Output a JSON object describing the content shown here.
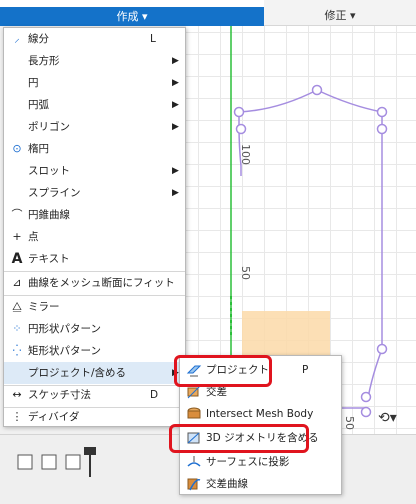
{
  "toolbar": {
    "create_label": "作成 ▾",
    "modify_label": "修正 ▾"
  },
  "create_menu": {
    "items": [
      {
        "label": "線分",
        "shortcut": "L",
        "icon": "line-icon"
      },
      {
        "label": "長方形",
        "submenu": true
      },
      {
        "label": "円",
        "submenu": true
      },
      {
        "label": "円弧",
        "submenu": true
      },
      {
        "label": "ポリゴン",
        "submenu": true
      },
      {
        "label": "楕円",
        "icon": "ellipse-icon"
      },
      {
        "label": "スロット",
        "submenu": true
      },
      {
        "label": "スプライン",
        "submenu": true
      },
      {
        "label": "円錐曲線",
        "icon": "conic-icon"
      },
      {
        "label": "点",
        "icon": "point-icon"
      },
      {
        "label": "テキスト",
        "icon": "text-icon"
      },
      {
        "label": "曲線をメッシュ断面にフィット",
        "icon": "fit-curve-icon"
      },
      {
        "label": "ミラー",
        "icon": "mirror-icon"
      },
      {
        "label": "円形状パターン",
        "icon": "circular-pattern-icon"
      },
      {
        "label": "矩形状パターン",
        "icon": "rectangular-pattern-icon"
      },
      {
        "label": "プロジェクト/含める",
        "submenu": true
      },
      {
        "label": "スケッチ寸法",
        "shortcut": "D",
        "icon": "dimension-icon"
      },
      {
        "label": "ディバイダ",
        "icon": "divider-icon"
      }
    ]
  },
  "submenu": {
    "items": [
      {
        "label": "プロジェクト",
        "shortcut": "P",
        "icon": "project-icon"
      },
      {
        "label": "交差",
        "icon": "intersect-icon"
      },
      {
        "label": "Intersect Mesh Body",
        "icon": "intersect-mesh-icon"
      },
      {
        "label": "3D ジオメトリを含める",
        "icon": "include-3d-icon"
      },
      {
        "label": "サーフェスに投影",
        "icon": "project-surface-icon"
      },
      {
        "label": "交差曲線",
        "icon": "intersection-curve-icon"
      }
    ]
  },
  "canvas": {
    "ruler_labels": [
      "100",
      "50"
    ],
    "bottom_ruler_label": "50"
  },
  "colors": {
    "accent": "#1472c9",
    "sketch": "#a58de0",
    "highlight_box": "#e0141e",
    "fill_region": "#fcd9a8"
  }
}
